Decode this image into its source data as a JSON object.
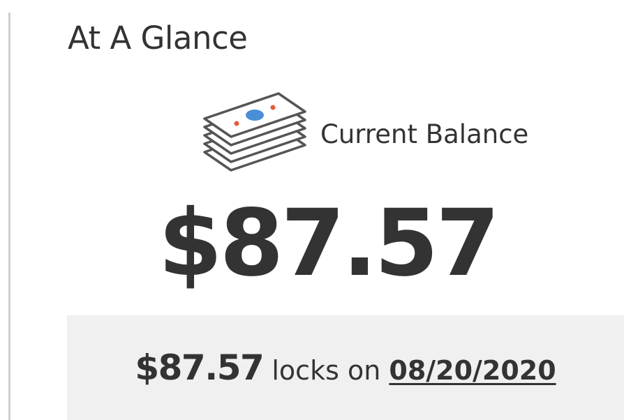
{
  "card": {
    "title": "At A Glance"
  },
  "balance": {
    "icon": "money-stack-icon",
    "label": "Current Balance",
    "amount": "$87.57"
  },
  "lock": {
    "amount": "$87.57",
    "text": "locks on",
    "date": "08/20/2020"
  },
  "colors": {
    "text": "#333333",
    "strip": "#f0f0f0",
    "border": "#cfcfcf",
    "icon_blue": "#4a8fd6",
    "icon_red": "#e25c3b"
  }
}
